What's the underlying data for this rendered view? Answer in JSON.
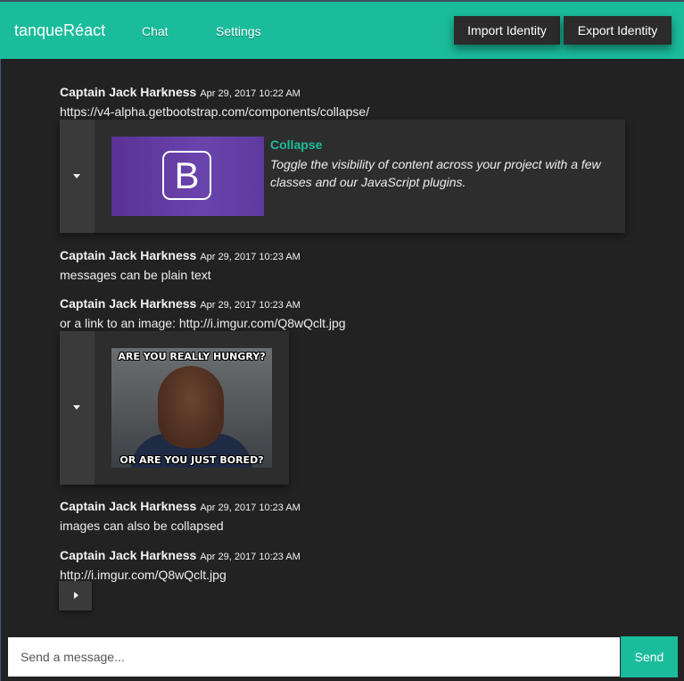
{
  "header": {
    "brand": "tanqueRéact",
    "nav": [
      {
        "label": "Chat"
      },
      {
        "label": "Settings"
      }
    ],
    "import_label": "Import Identity",
    "export_label": "Export Identity"
  },
  "messages": [
    {
      "author": "Captain Jack Harkness",
      "time": "Apr 29, 2017 10:22 AM",
      "text": "https://v4-alpha.getbootstrap.com/components/collapse/"
    },
    {
      "author": "Captain Jack Harkness",
      "time": "Apr 29, 2017 10:23 AM",
      "text": "messages can be plain text"
    },
    {
      "author": "Captain Jack Harkness",
      "time": "Apr 29, 2017 10:23 AM",
      "text": "or a link to an image: http://i.imgur.com/Q8wQclt.jpg"
    },
    {
      "author": "Captain Jack Harkness",
      "time": "Apr 29, 2017 10:23 AM",
      "text": "images can also be collapsed"
    },
    {
      "author": "Captain Jack Harkness",
      "time": "Apr 29, 2017 10:23 AM",
      "text": "http://i.imgur.com/Q8wQclt.jpg"
    }
  ],
  "link_preview": {
    "logo_letter": "B",
    "title": "Collapse",
    "description": "Toggle the visibility of content across your project with a few classes and our JavaScript plugins."
  },
  "image_preview": {
    "top_text": "ARE YOU REALLY HUNGRY?",
    "bottom_text": "OR ARE YOU JUST BORED?"
  },
  "composer": {
    "placeholder": "Send a message...",
    "value": "",
    "send_label": "Send"
  },
  "colors": {
    "accent": "#1abc9c",
    "background": "#222222",
    "panel": "#2d2d2d"
  },
  "icons": {
    "expanded_toggle": "caret-down-icon",
    "collapsed_toggle": "caret-right-icon"
  }
}
